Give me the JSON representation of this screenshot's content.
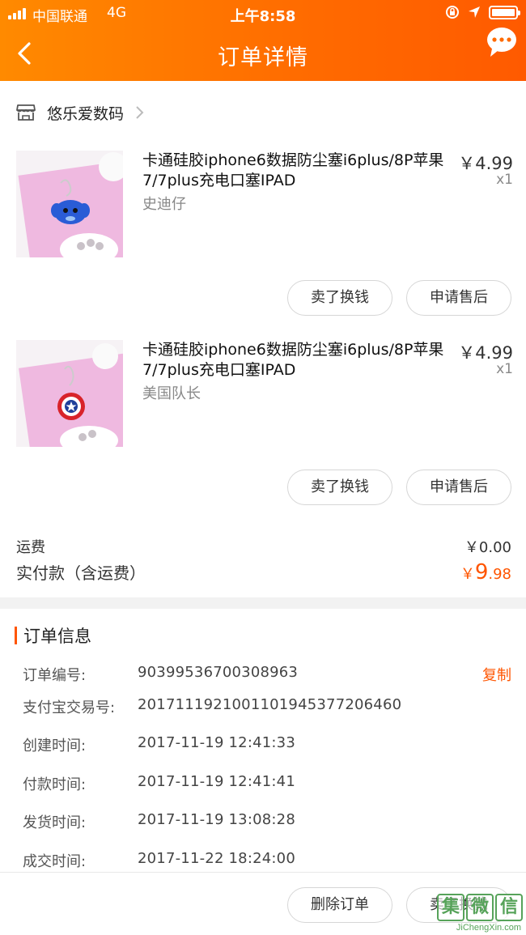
{
  "status_bar": {
    "carrier": "中国联通",
    "network": "4G",
    "time": "上午8:58"
  },
  "nav": {
    "title": "订单详情",
    "back_icon": "chevron-left-icon",
    "more_icon": "chat-bubble-icon"
  },
  "shop": {
    "icon": "store-icon",
    "name": "悠乐爱数码"
  },
  "items": [
    {
      "title": "卡通硅胶iphone6数据防尘塞i6plus/8P苹果7/7plus充电口塞IPAD",
      "variant": "史迪仔",
      "price": "￥4.99",
      "quantity": "x1",
      "actions": {
        "sell": "卖了换钱",
        "after_sale": "申请售后"
      }
    },
    {
      "title": "卡通硅胶iphone6数据防尘塞i6plus/8P苹果7/7plus充电口塞IPAD",
      "variant": "美国队长",
      "price": "￥4.99",
      "quantity": "x1",
      "actions": {
        "sell": "卖了换钱",
        "after_sale": "申请售后"
      }
    }
  ],
  "summary": {
    "shipping_label": "运费",
    "shipping_value": "￥0.00",
    "paid_label": "实付款（含运费）",
    "paid_currency": "￥",
    "paid_int": "9",
    "paid_dec": ".98"
  },
  "order_info": {
    "title": "订单信息",
    "copy_label": "复制",
    "rows": [
      {
        "key": "订单编号:",
        "value": "90399536700308963"
      },
      {
        "key": "支付宝交易号:",
        "value": "2017111921001101945377206460"
      },
      {
        "key": "创建时间:",
        "value": "2017-11-19 12:41:33"
      },
      {
        "key": "付款时间:",
        "value": "2017-11-19 12:41:41"
      },
      {
        "key": "发货时间:",
        "value": "2017-11-19 13:08:28"
      },
      {
        "key": "成交时间:",
        "value": "2017-11-22 18:24:00"
      }
    ]
  },
  "bottom_actions": {
    "delete": "删除订单",
    "sell": "卖了换钱"
  },
  "watermark": {
    "chars": [
      "集",
      "微",
      "信"
    ],
    "domain": "JiChengXin.com"
  },
  "colors": {
    "accent": "#ff5500",
    "header_start": "#ff8a00",
    "header_end": "#ff5a00"
  }
}
